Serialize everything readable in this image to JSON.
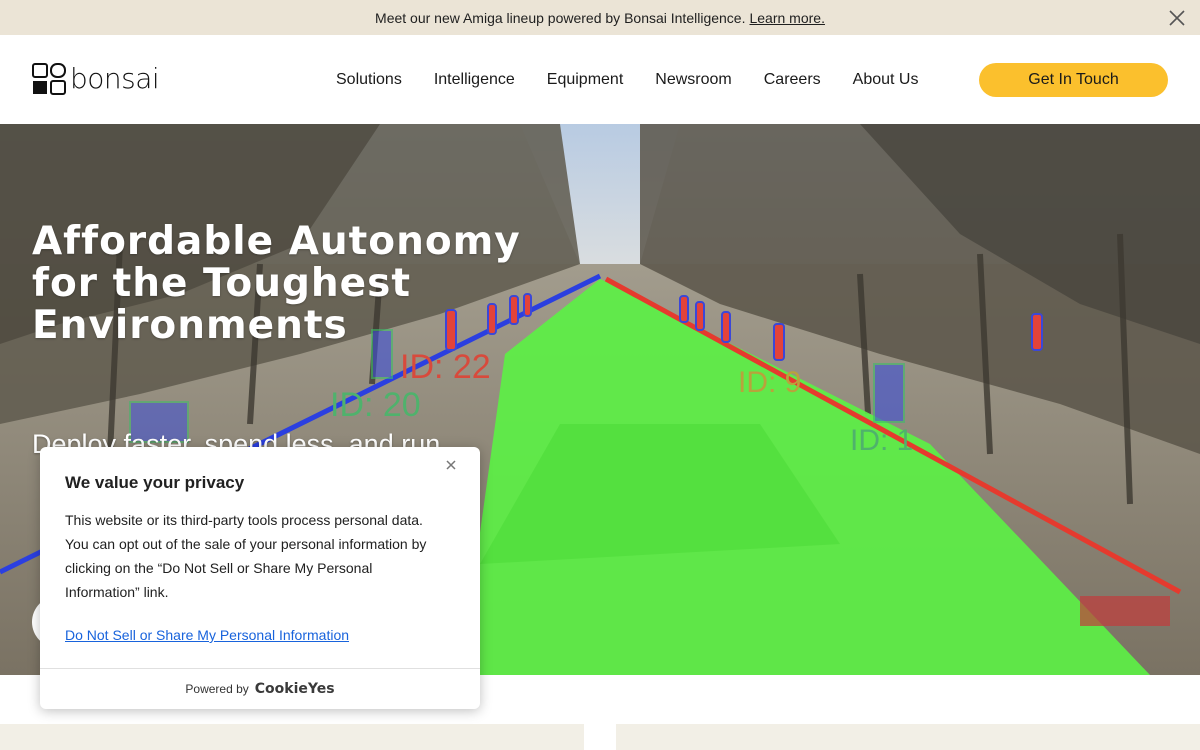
{
  "announcement": {
    "text": "Meet our new Amiga lineup powered by Bonsai Intelligence.",
    "link": "Learn more."
  },
  "header": {
    "logo_text": "bonsai",
    "nav": [
      {
        "label": "Solutions"
      },
      {
        "label": "Intelligence"
      },
      {
        "label": "Equipment"
      },
      {
        "label": "Newsroom"
      },
      {
        "label": "Careers"
      },
      {
        "label": "About Us"
      }
    ],
    "cta_label": "Get In Touch"
  },
  "hero": {
    "title": "Affordable Autonomy for the Toughest Environments",
    "subtitle_visible": "Deploy faster, spend less, and run",
    "detections": [
      {
        "label": "ID: 22"
      },
      {
        "label": "ID: 20"
      },
      {
        "label": "ID: 9"
      },
      {
        "label": "ID: 1"
      }
    ]
  },
  "cookie": {
    "title": "We value your privacy",
    "body": "This website or its third-party tools process personal data. You can opt out of the sale of your personal information by clicking on the “Do Not Sell or Share My Personal Information” link.",
    "link": "Do Not Sell or Share My Personal Information",
    "powered_by": "Powered by",
    "brand": "CookieYes"
  },
  "colors": {
    "announcement_bg": "#ebe4d6",
    "cta_bg": "#fbc02d",
    "path_overlay": "#5cf045",
    "left_boundary": "#2b3fe0",
    "right_boundary": "#e53a2e",
    "cookie_link": "#1863dc"
  }
}
